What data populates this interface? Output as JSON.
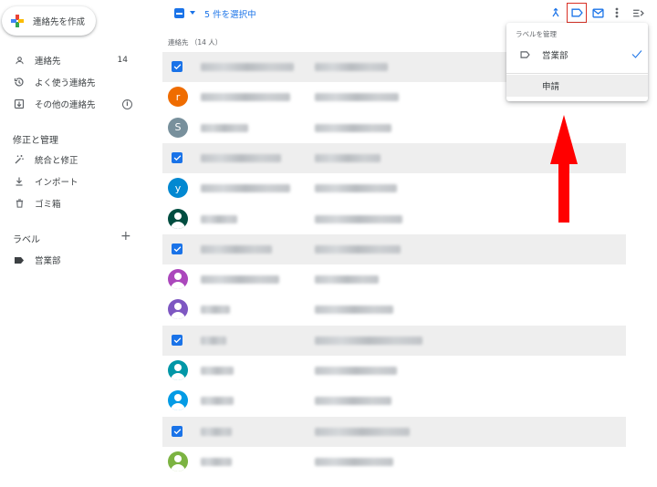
{
  "sidebar": {
    "create_label": "連絡先を作成",
    "nav": [
      {
        "label": "連絡先",
        "count": "14"
      },
      {
        "label": "よく使う連絡先"
      },
      {
        "label": "その他の連絡先"
      }
    ],
    "manage_heading": "修正と管理",
    "manage": [
      {
        "label": "統合と修正"
      },
      {
        "label": "インポート"
      },
      {
        "label": "ゴミ箱"
      }
    ],
    "labels_heading": "ラベル",
    "labels": [
      {
        "label": "営業部"
      }
    ]
  },
  "toolbar": {
    "selection_text": "5 件を選択中",
    "icons": [
      "merge-icon",
      "label-icon",
      "email-icon",
      "more-vert-icon",
      "hide-list-icon"
    ]
  },
  "list": {
    "header": "連絡先 （14 人）",
    "rows": [
      {
        "selected": true
      },
      {
        "selected": false,
        "avatar": {
          "type": "letter",
          "letter": "r",
          "color": "#ef6c00"
        }
      },
      {
        "selected": false,
        "avatar": {
          "type": "letter",
          "letter": "S",
          "color": "#78909c"
        }
      },
      {
        "selected": true
      },
      {
        "selected": false,
        "avatar": {
          "type": "letter",
          "letter": "y",
          "color": "#0288d1"
        }
      },
      {
        "selected": false,
        "avatar": {
          "type": "person",
          "color": "#004d40"
        }
      },
      {
        "selected": true
      },
      {
        "selected": false,
        "avatar": {
          "type": "person",
          "color": "#ab47bc"
        }
      },
      {
        "selected": false,
        "avatar": {
          "type": "person",
          "color": "#7e57c2"
        }
      },
      {
        "selected": true
      },
      {
        "selected": false,
        "avatar": {
          "type": "person",
          "color": "#0097a7"
        }
      },
      {
        "selected": false,
        "avatar": {
          "type": "person",
          "color": "#039be5"
        }
      },
      {
        "selected": true
      },
      {
        "selected": false,
        "avatar": {
          "type": "person",
          "color": "#7cb342"
        }
      }
    ]
  },
  "dropdown": {
    "title": "ラベルを管理",
    "items": [
      {
        "label": "営業部",
        "checked": true
      },
      {
        "label": "申請"
      }
    ]
  },
  "colors": {
    "accent": "#1a73e8",
    "highlight_frame": "#d93025",
    "annotation_arrow": "#ff0000"
  }
}
